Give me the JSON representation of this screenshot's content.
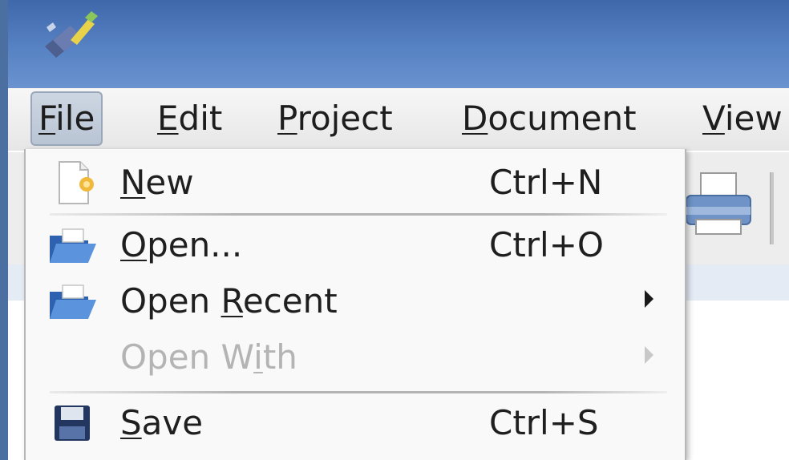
{
  "menubar": {
    "items": [
      {
        "pre": "",
        "u": "F",
        "post": "ile"
      },
      {
        "pre": "",
        "u": "E",
        "post": "dit"
      },
      {
        "pre": "",
        "u": "P",
        "post": "roject"
      },
      {
        "pre": "",
        "u": "D",
        "post": "ocument"
      },
      {
        "pre": "",
        "u": "V",
        "post": "iew"
      }
    ],
    "active": "File"
  },
  "file_menu": {
    "items": [
      {
        "pre": "",
        "u": "N",
        "post": "ew",
        "shortcut": "Ctrl+N",
        "icon": "new-document-icon",
        "enabled": true
      },
      {
        "pre": "",
        "u": "O",
        "post": "pen...",
        "shortcut": "Ctrl+O",
        "icon": "folder-open-icon",
        "enabled": true
      },
      {
        "pre": "Open ",
        "u": "R",
        "post": "ecent",
        "shortcut": "",
        "icon": "folder-open-icon",
        "enabled": true,
        "submenu": true
      },
      {
        "pre": "Open W",
        "u": "i",
        "post": "th",
        "shortcut": "",
        "icon": "",
        "enabled": false,
        "submenu": true
      },
      {
        "pre": "",
        "u": "S",
        "post": "ave",
        "shortcut": "Ctrl+S",
        "icon": "save-floppy-icon",
        "enabled": true
      }
    ]
  },
  "colors": {
    "titlebar": "#4f78b8",
    "menu_bg": "#f9f9f9",
    "disabled_text": "#b4b4b4",
    "active_menu": "#c3cddb"
  }
}
